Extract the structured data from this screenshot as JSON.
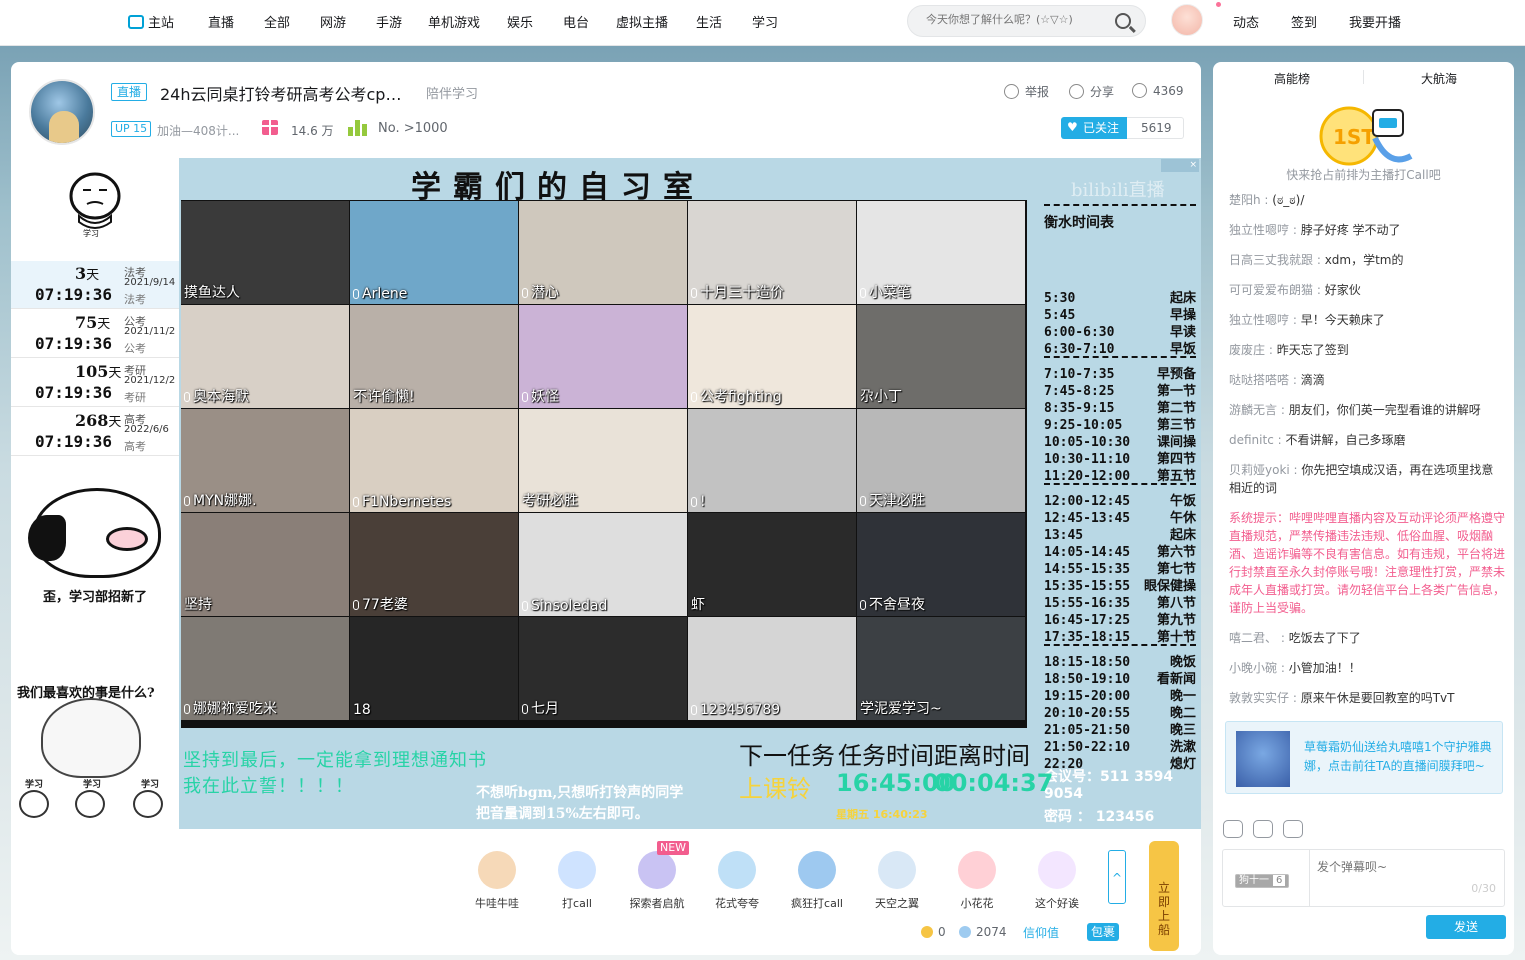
{
  "nav": {
    "home": "主站",
    "items": [
      "直播",
      "全部",
      "网游",
      "手游",
      "单机游戏",
      "娱乐",
      "电台",
      "虚拟主播",
      "生活",
      "学习"
    ],
    "search_placeholder": "今天你想了解什么呢？(☆▽☆)",
    "right": [
      "动态",
      "签到",
      "我要开播"
    ]
  },
  "room": {
    "live_tag": "直播",
    "title": "24h云同桌打铃考研高考公考cpa...",
    "area": "陪伴学习",
    "report": "举报",
    "share": "分享",
    "viewers": "4369",
    "up_level": "UP 15",
    "up_name": "加油—408计...",
    "popularity": "14.6 万",
    "rank": "No. >1000",
    "follow": "已关注",
    "followers": "5619"
  },
  "stream": {
    "watermark": "bilibili直播",
    "ad_close": "×",
    "grid_title": "学霸们的自习室",
    "mascot_label": "学习",
    "countdowns": [
      {
        "days": "3",
        "unit": "天",
        "time": "07:19:36",
        "type": "法考",
        "date": "2021/9/14"
      },
      {
        "days": "75",
        "unit": "天",
        "time": "07:19:36",
        "type": "公考",
        "date": "2021/11/2"
      },
      {
        "days": "105",
        "unit": "天",
        "time": "07:19:36",
        "type": "考研",
        "date": "2021/12/2"
      },
      {
        "days": "268",
        "unit": "天",
        "time": "07:19:36",
        "type": "高考",
        "date": "2022/6/6"
      }
    ],
    "poster1": "歪，学习部招新了",
    "poster2": "我们最喜欢的事是什么?",
    "study_labels": [
      "学习",
      "学习",
      "学习"
    ],
    "cells": [
      "摸鱼达人",
      "Arlene",
      "潜心",
      "十月三十造价",
      "小菜笔",
      "奥本海默",
      "不许偷懒!",
      "妖怪",
      "公考fighting",
      "尕小丁",
      "MYN娜娜.",
      "F1Nbernetes",
      "考研必胜",
      "!",
      "天津必胜",
      "坚持",
      "77老婆",
      "Sinsoledad",
      "虾",
      "不舍昼夜",
      "娜娜祢爱吃米",
      "18",
      "七月",
      "123456789",
      "学泥爱学习~"
    ],
    "timetable_title": "衡水时间表",
    "timetable": [
      [
        "5:30",
        "起床"
      ],
      [
        "5:45",
        "早操"
      ],
      [
        "6:00-6:30",
        "早读"
      ],
      [
        "6:30-7:10",
        "早饭"
      ],
      [
        "7:10-7:35",
        "早预备"
      ],
      [
        "7:45-8:25",
        "第一节"
      ],
      [
        "8:35-9:15",
        "第二节"
      ],
      [
        "9:25-10:05",
        "第三节"
      ],
      [
        "10:05-10:30",
        "课间操"
      ],
      [
        "10:30-11:10",
        "第四节"
      ],
      [
        "11:20-12:00",
        "第五节"
      ],
      [
        "12:00-12:45",
        "午饭"
      ],
      [
        "12:45-13:45",
        "午休"
      ],
      [
        "13:45",
        "起床"
      ],
      [
        "14:05-14:45",
        "第六节"
      ],
      [
        "14:55-15:35",
        "第七节"
      ],
      [
        "15:35-15:55",
        "眼保健操"
      ],
      [
        "15:55-16:35",
        "第八节"
      ],
      [
        "16:45-17:25",
        "第九节"
      ],
      [
        "17:35-18:15",
        "第十节"
      ],
      [
        "18:15-18:50",
        "晚饭"
      ],
      [
        "18:50-19:10",
        "看新闻"
      ],
      [
        "19:15-20:00",
        "晚一"
      ],
      [
        "20:10-20:55",
        "晚二"
      ],
      [
        "21:05-21:50",
        "晚三"
      ],
      [
        "21:50-22:10",
        "洗漱"
      ],
      [
        "22:20",
        "熄灯"
      ]
    ],
    "banner_line1": "坚持到最后，一定能拿到理想通知书",
    "banner_line2": "我在此立誓！！！！",
    "bgm_line1": "不想听bgm,只想听打铃声的同学",
    "bgm_line2": "把音量调到15%左右即可。",
    "next_task_h": "下一任务",
    "task_time_h": "任务时间",
    "remaining_h": "距离时间",
    "next_task": "上课铃",
    "task_time": "16:45:00",
    "remaining": "00:04:37",
    "date_line": "星期五 16:40:23",
    "meeting_id": "会议号：511 3594 9054",
    "password": "密码  ：  123456"
  },
  "gifts": {
    "items": [
      {
        "name": "牛哇牛哇",
        "color": "#f6d9b8"
      },
      {
        "name": "打call",
        "color": "#cfe3ff"
      },
      {
        "name": "探索者启航",
        "color": "#c9c3f3"
      },
      {
        "name": "花式夸夸",
        "color": "#bfe0f7"
      },
      {
        "name": "疯狂打call",
        "color": "#9ec9f0"
      },
      {
        "name": "天空之翼",
        "color": "#d9e8f6"
      },
      {
        "name": "小花花",
        "color": "#ffd0d6"
      },
      {
        "name": "这个好诶",
        "color": "#f3e6ff"
      }
    ],
    "new_tag": "NEW",
    "gold": "0",
    "silver": "2074",
    "recharge": "信仰值",
    "pack": "包裹",
    "board": "立即上船",
    "up_arrow": "^"
  },
  "side": {
    "tab1": "高能榜",
    "tab2": "大航海",
    "badge_text": "1ST",
    "badge_sub": "快来抢占前排为主播打Call吧",
    "danmu": [
      {
        "user": "楚阳h",
        "text": "(ಠ_ಠ)/",
        "sys": false
      },
      {
        "user": "独立性嗯哼",
        "text": "脖子好疼 学不动了",
        "sys": false
      },
      {
        "user": "日高三丈我就跟",
        "text": "xdm，学tm的",
        "sys": false
      },
      {
        "user": "可可爱爱布朗猫",
        "text": "好家伙",
        "sys": false
      },
      {
        "user": "独立性嗯哼",
        "text": "早！今天赖床了",
        "sys": false
      },
      {
        "user": "废废庄",
        "text": "昨天忘了签到",
        "sys": false
      },
      {
        "user": "哒哒搭嗒嗒",
        "text": "滴滴",
        "sys": false
      },
      {
        "user": "游麟无言",
        "text": "朋友们，你们英一完型看谁的讲解呀",
        "sys": false
      },
      {
        "user": "definitc",
        "text": "不看讲解，自己多琢磨",
        "sys": false
      },
      {
        "user": "贝莉娅yoki",
        "text": "你先把空填成汉语，再在选项里找意相近的词",
        "sys": false
      },
      {
        "user": "",
        "text": "系统提示：哔哩哔哩直播内容及互动评论须严格遵守直播规范，严禁传播违法违规、低俗血腥、吸烟酗酒、造谣诈骗等不良有害信息。如有违规，平台将进行封禁直至永久封停账号哦！注意理性打赏，严禁未成年人直播或打赏。请勿轻信平台上各类广告信息，谨防上当受骗。",
        "sys": true
      },
      {
        "user": "嘻二君、",
        "text": "吃饭去了下了",
        "sys": false
      },
      {
        "user": "小晚小碗",
        "text": "小管加油！！",
        "sys": false
      },
      {
        "user": "敦敦实实仔",
        "text": "原来午休是要回教室的吗TvT",
        "sys": false
      }
    ],
    "guard_text": "草莓霜奶仙送给丸嘻嘻1个守护雅典娜，点击前往TA的直播间膜拜吧~",
    "medal_name": "狗十一",
    "medal_level": "6",
    "input_placeholder": "发个弹幕呗~",
    "char_count": "0/30",
    "send": "发送"
  }
}
